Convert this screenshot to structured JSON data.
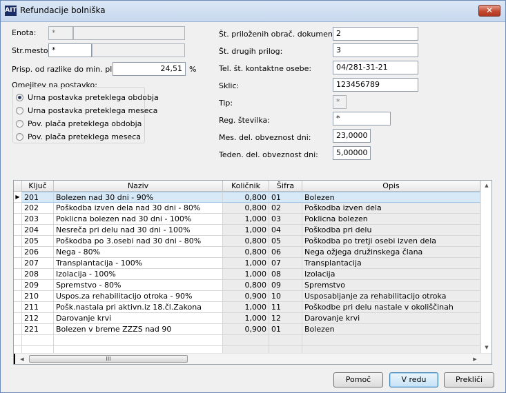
{
  "window": {
    "title": "Refundacije bolniška",
    "icon_text": "AIT"
  },
  "form": {
    "enota": {
      "label": "Enota:",
      "code": "*",
      "name": ""
    },
    "strmesto": {
      "label": "Str.mesto:",
      "code": "*",
      "name": ""
    },
    "prisp": {
      "label": "Prisp. od razlike do min. plače:",
      "value": "24,51",
      "unit": "%"
    },
    "omejitev": {
      "label": "Omejitev na postavko:",
      "options": [
        "Urna postavka preteklega obdobja",
        "Urna postavka preteklega meseca",
        "Pov. plača preteklega obdobja",
        "Pov. plača preteklega meseca"
      ],
      "selected": 0
    },
    "st_prilozenih": {
      "label": "Št. priloženih obrač. dokumentov:",
      "value": "2"
    },
    "st_drugih": {
      "label": "Št. drugih prilog:",
      "value": "3"
    },
    "tel": {
      "label": "Tel. št. kontaktne osebe:",
      "value": "04/281-31-21"
    },
    "sklic": {
      "label": "Sklic:",
      "value": "123456789"
    },
    "tip": {
      "label": "Tip:",
      "value": "*"
    },
    "reg": {
      "label": "Reg. številka:",
      "value": "*"
    },
    "mes": {
      "label": "Mes. del. obveznost dni:",
      "value": "23,0000"
    },
    "teden": {
      "label": "Teden. del. obveznost dni:",
      "value": "5,00000"
    }
  },
  "grid": {
    "columns": [
      "Ključ",
      "Naziv",
      "Količnik",
      "Šifra",
      "Opis"
    ],
    "rows": [
      [
        "201",
        "Bolezen nad 30 dni - 90%",
        "0,800",
        "01",
        "Bolezen"
      ],
      [
        "202",
        "Poškodba izven dela nad 30 dni - 80%",
        "0,800",
        "02",
        "Poškodba izven dela"
      ],
      [
        "203",
        "Poklicna bolezen nad 30 dni - 100%",
        "1,000",
        "03",
        "Poklicna bolezen"
      ],
      [
        "204",
        "Nesreča pri delu nad 30 dni - 100%",
        "1,000",
        "04",
        "Poškodba pri delu"
      ],
      [
        "205",
        "Poškodba po 3.osebi nad 30 dni - 80%",
        "0,800",
        "05",
        "Poškodba po tretji osebi izven dela"
      ],
      [
        "206",
        "Nega - 80%",
        "0,800",
        "06",
        "Nega ožjega družinskega člana"
      ],
      [
        "207",
        "Transplantacija - 100%",
        "1,000",
        "07",
        "Transplantacija"
      ],
      [
        "208",
        "Izolacija - 100%",
        "1,000",
        "08",
        "Izolacija"
      ],
      [
        "209",
        "Spremstvo - 80%",
        "0,800",
        "09",
        "Spremstvo"
      ],
      [
        "210",
        "Uspos.za rehabilitacijo otroka - 90%",
        "0,900",
        "10",
        "Usposabljanje za rehabilitacijo otroka"
      ],
      [
        "211",
        "Pošk.nastala pri aktivn.iz 18.čl.Zakona",
        "1,000",
        "11",
        "Poškodbe pri delu nastale v okoliščinah"
      ],
      [
        "212",
        "Darovanje krvi",
        "1,000",
        "12",
        "Darovanje krvi"
      ],
      [
        "221",
        "Bolezen v breme ZZZS nad 90",
        "0,900",
        "01",
        "Bolezen"
      ]
    ],
    "selected_row": 0,
    "hscroll_grip": "III"
  },
  "buttons": {
    "pomoc": "Pomoč",
    "vredu": "V redu",
    "preklici": "Prekliči"
  },
  "icons": {
    "close": "close-icon",
    "radio": "radio-icon"
  }
}
